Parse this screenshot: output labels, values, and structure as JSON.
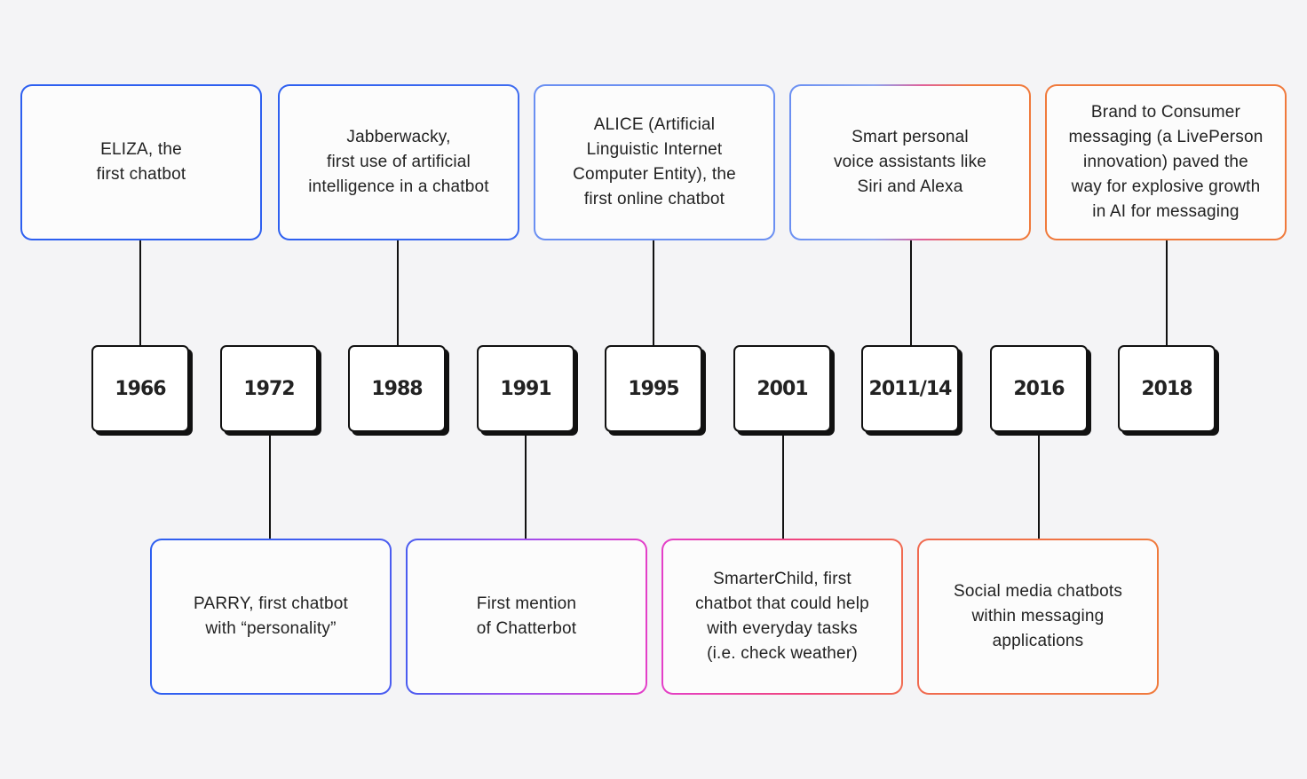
{
  "colors": {
    "blue": "#2d5ff0",
    "light_blue": "#6a8ff2",
    "magenta": "#e43fc8",
    "pink": "#f0457a",
    "orange": "#f07a3c",
    "line": "#111111",
    "background": "#f4f4f6"
  },
  "years": [
    "1966",
    "1972",
    "1988",
    "1991",
    "1995",
    "2001",
    "2011/14",
    "2016",
    "2018"
  ],
  "top_events": [
    {
      "year": "1966",
      "text": "ELIZA, the\nfirst chatbot"
    },
    {
      "year": "1988",
      "text": "Jabberwacky,\nfirst use of artificial\nintelligence in a chatbot"
    },
    {
      "year": "1995",
      "text": "ALICE (Artificial\nLinguistic Internet\nComputer Entity), the\nfirst online chatbot"
    },
    {
      "year": "2011/14",
      "text": "Smart personal\nvoice assistants like\nSiri and Alexa"
    },
    {
      "year": "2018",
      "text": "Brand to Consumer\nmessaging (a LivePerson\ninnovation) paved the\nway for explosive growth\nin AI for messaging"
    }
  ],
  "bottom_events": [
    {
      "year": "1972",
      "text": "PARRY, first chatbot\nwith “personality”"
    },
    {
      "year": "1991",
      "text": "First mention\nof Chatterbot"
    },
    {
      "year": "2001",
      "text": "SmarterChild, first\nchatbot that could help\nwith everyday tasks\n(i.e. check weather)"
    },
    {
      "year": "2016",
      "text": "Social media chatbots\nwithin messaging\napplications"
    }
  ]
}
